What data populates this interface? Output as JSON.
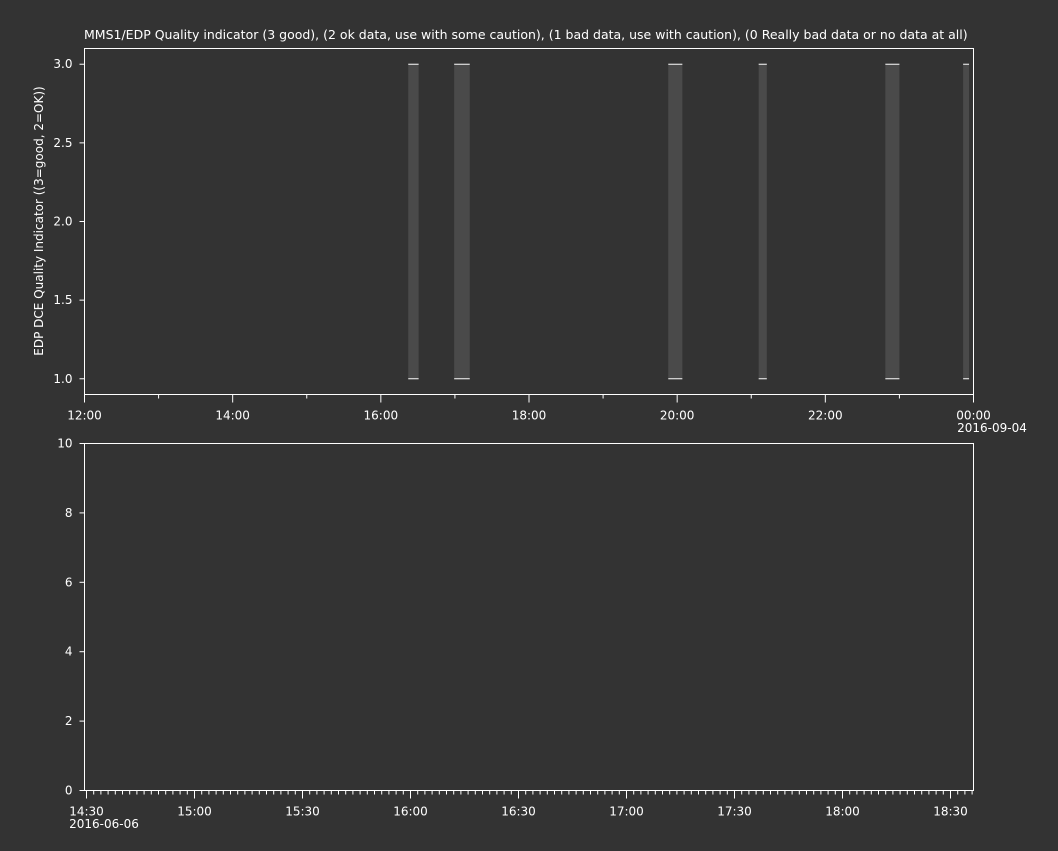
{
  "colors": {
    "background": "#333333",
    "axis": "#ffffff",
    "text": "#ffffff",
    "band_fill": "#4a4a4a",
    "band_edge": "#ffffff"
  },
  "chart_data": [
    {
      "type": "bar",
      "title": "MMS1/EDP  Quality indicator (3 good), (2 ok data, use with some caution), (1 bad data, use with caution), (0 Really bad data or no data at all)",
      "ylabel": "EDP DCE Quality Indicator ((3=good, 2=OK))",
      "xlabel": "",
      "x_axis": "time (hours)",
      "xlim": [
        12,
        24
      ],
      "ylim": [
        0.9,
        3.1
      ],
      "yticks": [
        1.0,
        1.5,
        2.0,
        2.5,
        3.0
      ],
      "ytick_labels": [
        "1.0",
        "1.5",
        "2.0",
        "2.5",
        "3.0"
      ],
      "xticks": [
        12,
        14,
        16,
        18,
        20,
        22,
        24
      ],
      "xtick_labels": [
        "12:00",
        "14:00",
        "16:00",
        "18:00",
        "20:00",
        "22:00",
        "00:00"
      ],
      "x_minor_ticks": [
        13,
        15,
        17,
        19,
        21,
        23
      ],
      "date_label": "2016-09-04",
      "grid": false,
      "bands": [
        {
          "start": 16.37,
          "end": 16.51,
          "low": 1.0,
          "high": 3.0
        },
        {
          "start": 16.99,
          "end": 17.2,
          "low": 1.0,
          "high": 3.0
        },
        {
          "start": 19.88,
          "end": 20.07,
          "low": 1.0,
          "high": 3.0
        },
        {
          "start": 21.1,
          "end": 21.21,
          "low": 1.0,
          "high": 3.0
        },
        {
          "start": 22.81,
          "end": 23.0,
          "low": 1.0,
          "high": 3.0
        },
        {
          "start": 23.86,
          "end": 23.94,
          "low": 1.0,
          "high": 3.0
        }
      ]
    },
    {
      "type": "line",
      "title": "",
      "ylabel": "",
      "xlabel": "",
      "x_axis": "time (minutes since 14:30)",
      "xlim": [
        0,
        248
      ],
      "ylim": [
        0,
        10
      ],
      "yticks": [
        0,
        2,
        4,
        6,
        8,
        10
      ],
      "ytick_labels": [
        "0",
        "2",
        "4",
        "6",
        "8",
        "10"
      ],
      "xticks": [
        0,
        30,
        60,
        90,
        120,
        150,
        180,
        210,
        240
      ],
      "xtick_labels": [
        "14:30",
        "15:00",
        "15:30",
        "16:00",
        "16:30",
        "17:00",
        "17:30",
        "18:00",
        "18:30"
      ],
      "minor_tick_step": 2,
      "date_label": "2016-06-06",
      "grid": false,
      "series": []
    }
  ]
}
